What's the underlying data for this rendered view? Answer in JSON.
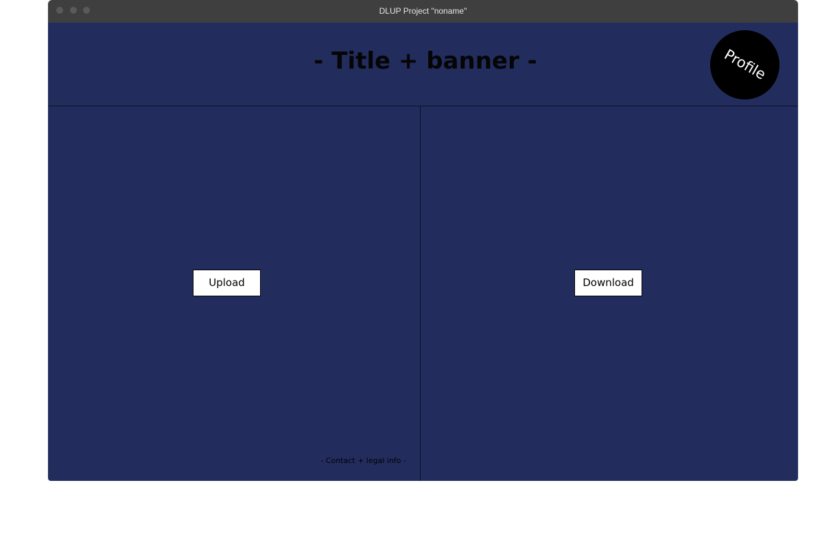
{
  "window": {
    "title": "DLUP Project \"noname\""
  },
  "header": {
    "banner_title": "- Title + banner -",
    "profile_label": "Profile"
  },
  "left_panel": {
    "upload_label": "Upload",
    "footer_text": "- Contact + legal info -"
  },
  "right_panel": {
    "download_label": "Download"
  },
  "colors": {
    "titlebar": "#3f3f3f",
    "background": "#222d5e",
    "profile_circle": "#000000",
    "button_background": "#ffffff"
  }
}
